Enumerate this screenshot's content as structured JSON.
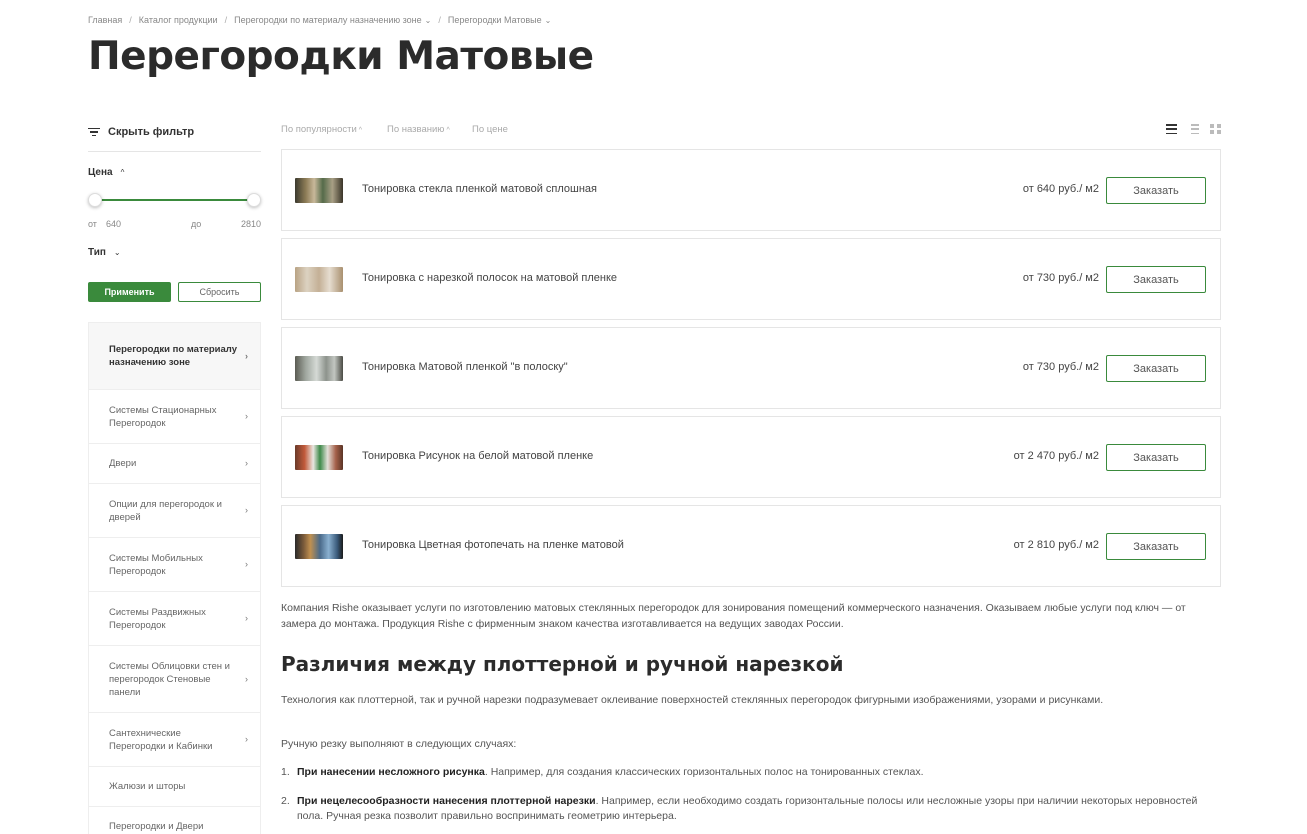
{
  "breadcrumb": {
    "items": [
      {
        "label": "Главная",
        "dropdown": false
      },
      {
        "label": "Каталог продукции",
        "dropdown": false
      },
      {
        "label": "Перегородки по материалу назначению зоне",
        "dropdown": true
      },
      {
        "label": "Перегородки Матовые",
        "dropdown": true
      }
    ],
    "separator": "/"
  },
  "page": {
    "title": "Перегородки Матовые"
  },
  "filter": {
    "toggle_label": "Скрыть фильтр",
    "price_label": "Цена",
    "from_label": "от",
    "from_value": "640",
    "to_label": "до",
    "to_value": "2810",
    "type_label": "Тип",
    "apply_label": "Применить",
    "reset_label": "Сбросить"
  },
  "categories": [
    {
      "label": "Перегородки по материалу назначению зоне",
      "active": true
    },
    {
      "label": "Системы Стационарных Перегородок",
      "active": false
    },
    {
      "label": "Двери",
      "active": false
    },
    {
      "label": "Опции для перегородок и дверей",
      "active": false
    },
    {
      "label": "Системы Мобильных Перегородок",
      "active": false
    },
    {
      "label": "Системы Раздвижных Перегородок",
      "active": false
    },
    {
      "label": "Системы Облицовки стен и перегородок Стеновые панели",
      "active": false
    },
    {
      "label": "Сантехнические Перегородки и Кабинки",
      "active": false
    },
    {
      "label": "Жалюзи и шторы",
      "active": false
    },
    {
      "label": "Перегородки и Двери",
      "active": false
    }
  ],
  "sort": {
    "popularity": "По популярности",
    "name": "По названию",
    "price": "По цене"
  },
  "products": [
    {
      "name": "Тонировка стекла пленкой матовой сплошная",
      "price": "от  640 руб./ м2",
      "order_label": "Заказать"
    },
    {
      "name": "Тонировка с нарезкой полосок на матовой пленке",
      "price": "от  730 руб./ м2",
      "order_label": "Заказать"
    },
    {
      "name": "Тонировка Матовой пленкой \"в полоску\"",
      "price": "от  730 руб./ м2",
      "order_label": "Заказать"
    },
    {
      "name": "Тонировка Рисунок на белой матовой пленке",
      "price": "от  2 470 руб./ м2",
      "order_label": "Заказать"
    },
    {
      "name": "Тонировка Цветная фотопечать на пленке матовой",
      "price": "от  2 810 руб./ м2",
      "order_label": "Заказать"
    }
  ],
  "content": {
    "intro": "Компания Rishe оказывает услуги по изготовлению матовых стеклянных перегородок для зонирования помещений коммерческого назначения. Оказываем любые услуги под ключ — от замера до монтажа. Продукция Rishe с фирменным знаком качества изготавливается на ведущих заводах России.",
    "heading": "Различия между плоттерной и ручной нарезкой",
    "p2": "Технология как плоттерной, так и ручной нарезки подразумевает оклеивание поверхностей стеклянных перегородок фигурными изображениями, узорами и рисунками.",
    "p3": "Ручную резку выполняют в следующих случаях:",
    "list": [
      {
        "num": "1.",
        "bold": "При нанесении несложного рисунка",
        "text": ". Например, для создания классических горизонтальных полос на тонированных стеклах."
      },
      {
        "num": "2.",
        "bold": "При нецелесообразности нанесения плоттерной нарезки",
        "text": ". Например, если необходимо создать горизонтальные полосы или несложные узоры при наличии некоторых неровностей пола. Ручная резка позволит правильно воспринимать геометрию интерьера."
      }
    ]
  },
  "colors": {
    "accent": "#3a8a3c"
  }
}
